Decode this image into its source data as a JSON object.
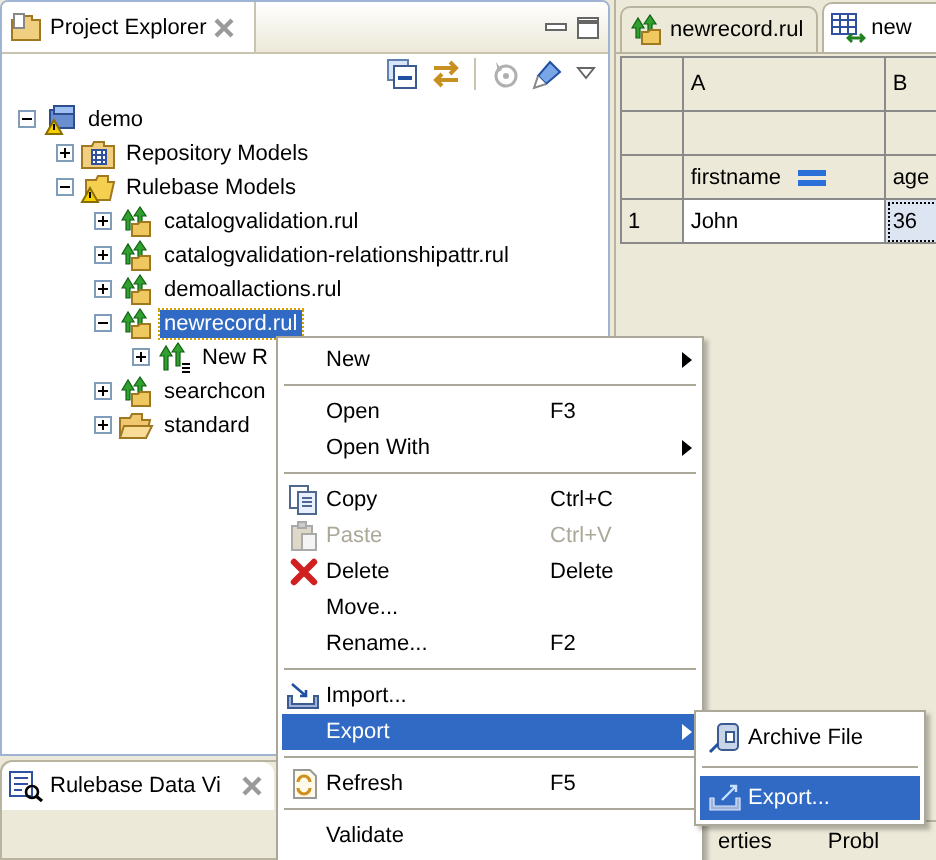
{
  "explorer": {
    "title": "Project Explorer",
    "tree": [
      {
        "label": "demo",
        "kind": "project",
        "expanded": true,
        "selected": false,
        "children": [
          {
            "label": "Repository Models",
            "kind": "repository",
            "expanded": false,
            "selected": false
          },
          {
            "label": "Rulebase Models",
            "kind": "rulebase",
            "expanded": true,
            "selected": false,
            "children": [
              {
                "label": "catalogvalidation.rul",
                "kind": "rules",
                "expanded": false,
                "selected": false
              },
              {
                "label": "catalogvalidation-relationshipattr.rul",
                "kind": "rules",
                "expanded": false,
                "selected": false
              },
              {
                "label": "demoallactions.rul",
                "kind": "rules",
                "expanded": false,
                "selected": false
              },
              {
                "label": "newrecord.rul",
                "kind": "rules",
                "expanded": true,
                "selected": true,
                "children": [
                  {
                    "label": "New R",
                    "kind": "record",
                    "expanded": false,
                    "selected": false
                  }
                ]
              },
              {
                "label": "searchcon",
                "kind": "rules",
                "expanded": false,
                "selected": false
              },
              {
                "label": "standard",
                "kind": "folder",
                "expanded": false,
                "selected": false
              }
            ]
          }
        ]
      }
    ]
  },
  "editor": {
    "tabs": [
      {
        "label": "newrecord.rul",
        "kind": "rules",
        "selected": false
      },
      {
        "label": "new",
        "kind": "table",
        "selected": true
      }
    ],
    "table": {
      "columns": [
        "A",
        "B"
      ],
      "fields": [
        "firstname",
        "age"
      ],
      "rows": [
        {
          "number": "1",
          "cells": [
            {
              "text": "John",
              "selected": false
            },
            {
              "text": "36",
              "selected": true
            }
          ]
        }
      ]
    }
  },
  "bottom_left": {
    "tab": "Rulebase Data Vi"
  },
  "bottom_right": {
    "tabs": [
      "erties",
      "Probl"
    ]
  },
  "context_menu": {
    "items": [
      {
        "kind": "plain",
        "label": "New",
        "submenu": true,
        "disabled": false,
        "selected": false
      },
      {
        "kind": "separator"
      },
      {
        "kind": "plain",
        "label": "Open",
        "shortcut": "F3",
        "submenu": false,
        "disabled": false,
        "selected": false
      },
      {
        "kind": "plain",
        "label": "Open With",
        "submenu": true,
        "disabled": false,
        "selected": false
      },
      {
        "kind": "separator"
      },
      {
        "kind": "copy",
        "label": "Copy",
        "shortcut": "Ctrl+C",
        "submenu": false,
        "disabled": false,
        "selected": false
      },
      {
        "kind": "paste",
        "label": "Paste",
        "shortcut": "Ctrl+V",
        "submenu": false,
        "disabled": true,
        "selected": false
      },
      {
        "kind": "delete",
        "label": "Delete",
        "shortcut": "Delete",
        "submenu": false,
        "disabled": false,
        "selected": false
      },
      {
        "kind": "plain",
        "label": "Move...",
        "submenu": false,
        "disabled": false,
        "selected": false
      },
      {
        "kind": "plain",
        "label": "Rename...",
        "shortcut": "F2",
        "submenu": false,
        "disabled": false,
        "selected": false
      },
      {
        "kind": "separator"
      },
      {
        "kind": "import",
        "label": "Import...",
        "submenu": false,
        "disabled": false,
        "selected": false
      },
      {
        "kind": "plain",
        "label": "Export",
        "submenu": true,
        "disabled": false,
        "selected": true
      },
      {
        "kind": "separator"
      },
      {
        "kind": "refresh",
        "label": "Refresh",
        "shortcut": "F5",
        "submenu": false,
        "disabled": false,
        "selected": false
      },
      {
        "kind": "separator"
      },
      {
        "kind": "plain",
        "label": "Validate",
        "submenu": false,
        "disabled": false,
        "selected": false
      }
    ]
  },
  "submenu": {
    "items": [
      {
        "kind": "archive",
        "label": "Archive File",
        "selected": false
      },
      {
        "kind": "separator"
      },
      {
        "kind": "export",
        "label": "Export...",
        "selected": true
      }
    ]
  }
}
